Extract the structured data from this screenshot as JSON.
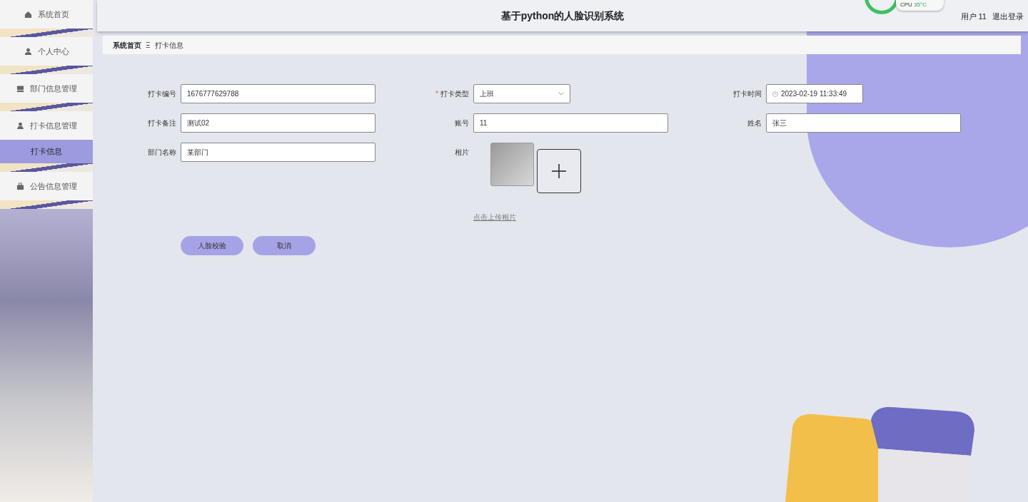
{
  "header": {
    "title": "基于python的人脸识别系统",
    "user_label": "用户 11",
    "logout": "退出登录"
  },
  "cpu_widget": {
    "label": "CPU",
    "temp": "35°C"
  },
  "sidebar": {
    "items": [
      {
        "label": "系统首页",
        "selected": false
      },
      {
        "label": "个人中心",
        "selected": false
      },
      {
        "label": "部门信息管理",
        "selected": false
      },
      {
        "label": "打卡信息管理",
        "selected": false,
        "children": [
          {
            "label": "打卡信息",
            "selected": true
          }
        ]
      },
      {
        "label": "公告信息管理",
        "selected": false
      }
    ]
  },
  "breadcrumb": {
    "home": "系统首页",
    "separator": "Ξ",
    "current": "打卡信息"
  },
  "form": {
    "fields": [
      {
        "kind": "text",
        "label": "打卡编号",
        "value": "1676777629788"
      },
      {
        "kind": "select",
        "label": "打卡类型",
        "value": "上班",
        "required_mark": "*"
      },
      {
        "kind": "datetime",
        "label": "打卡时间",
        "value": "2023-02-19 11:33:49"
      },
      {
        "kind": "text",
        "label": "打卡备注",
        "value": "测试02"
      },
      {
        "kind": "text",
        "label": "账号",
        "value": "11"
      },
      {
        "kind": "text",
        "label": "姓名",
        "value": "张三"
      },
      {
        "kind": "text",
        "label": "部门名称",
        "value": "某部门"
      },
      {
        "kind": "photo",
        "label": "相片",
        "hint": "点击上传相片"
      }
    ],
    "buttons": [
      "人脸校验",
      "取消"
    ]
  }
}
